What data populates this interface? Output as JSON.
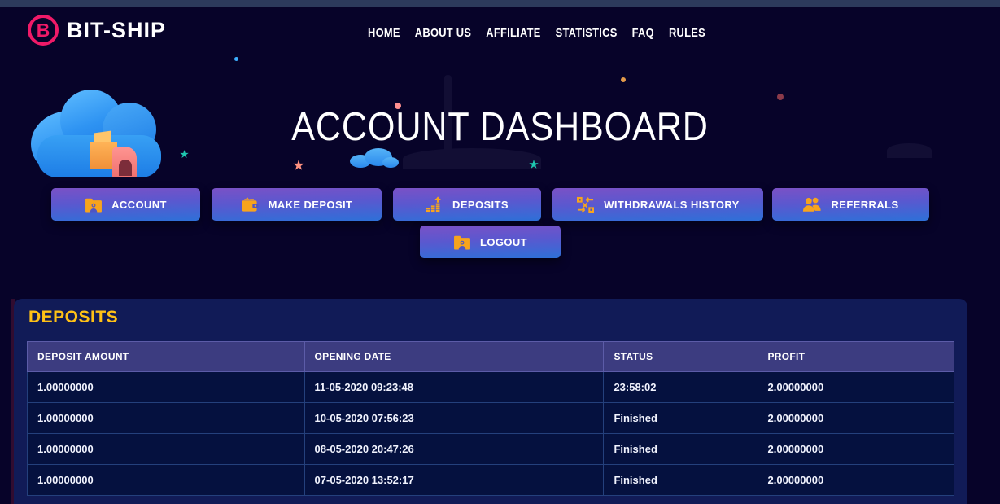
{
  "brand": {
    "name": "BIT-SHIP",
    "logo_letter": "B"
  },
  "nav": {
    "home": "HOME",
    "about": "ABOUT US",
    "affiliate": "AFFILIATE",
    "statistics": "STATISTICS",
    "faq": "FAQ",
    "rules": "RULES"
  },
  "hero": {
    "title": "ACCOUNT DASHBOARD"
  },
  "actions": {
    "account": {
      "label": "ACCOUNT"
    },
    "make_deposit": {
      "label": "MAKE DEPOSIT"
    },
    "deposits": {
      "label": "DEPOSITS"
    },
    "withdrawals_history": {
      "label": "WITHDRAWALS HISTORY"
    },
    "referrals": {
      "label": "REFERRALS"
    },
    "logout": {
      "label": "LOGOUT"
    }
  },
  "deposits_panel": {
    "title": "DEPOSITS",
    "table": {
      "columns": [
        "DEPOSIT AMOUNT",
        "OPENING DATE",
        "STATUS",
        "PROFIT"
      ],
      "rows": [
        [
          "1.00000000",
          "11-05-2020 09:23:48",
          "23:58:02",
          "2.00000000"
        ],
        [
          "1.00000000",
          "10-05-2020 07:56:23",
          "Finished",
          "2.00000000"
        ],
        [
          "1.00000000",
          "08-05-2020 20:47:26",
          "Finished",
          "2.00000000"
        ],
        [
          "1.00000000",
          "07-05-2020 13:52:17",
          "Finished",
          "2.00000000"
        ]
      ]
    }
  },
  "colors": {
    "accent_pink": "#f01a68",
    "accent_yellow": "#ffc116",
    "icon_orange": "#f7a41d",
    "btn_top": "#7a51c6",
    "btn_bottom": "#2e70d8",
    "panel_bg": "#111b57",
    "thead_bg": "#3c3c80",
    "row_bg": "#05113f"
  }
}
